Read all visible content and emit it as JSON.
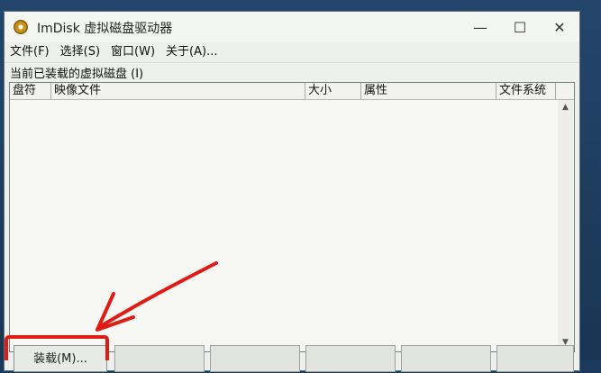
{
  "window": {
    "title": "ImDisk 虚拟磁盘驱动器",
    "controls": {
      "minimize": "—",
      "maximize": "☐",
      "close": "✕"
    }
  },
  "menu": {
    "items": [
      "文件(F)",
      "选择(S)",
      "窗口(W)",
      "关于(A)..."
    ]
  },
  "section": {
    "label": "当前已装载的虚拟磁盘 (I)"
  },
  "table": {
    "columns": [
      "盘符",
      "映像文件",
      "大小",
      "属性",
      "文件系统"
    ],
    "rows": []
  },
  "buttons": {
    "mount": "装载(M)..."
  },
  "annotation": {
    "color": "#e01b14"
  },
  "icons": {
    "app": "imdisk-disk-icon",
    "scroll_up": "▲",
    "scroll_down": "▼"
  }
}
